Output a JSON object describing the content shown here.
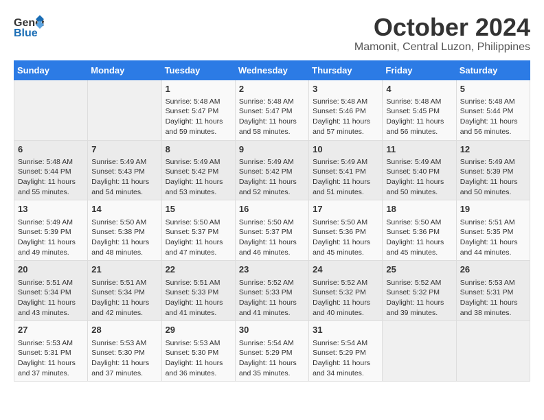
{
  "header": {
    "logo_line1": "General",
    "logo_line2": "Blue",
    "month_title": "October 2024",
    "subtitle": "Mamonit, Central Luzon, Philippines"
  },
  "days_of_week": [
    "Sunday",
    "Monday",
    "Tuesday",
    "Wednesday",
    "Thursday",
    "Friday",
    "Saturday"
  ],
  "weeks": [
    [
      {
        "day": "",
        "content": ""
      },
      {
        "day": "",
        "content": ""
      },
      {
        "day": "1",
        "content": "Sunrise: 5:48 AM\nSunset: 5:47 PM\nDaylight: 11 hours and 59 minutes."
      },
      {
        "day": "2",
        "content": "Sunrise: 5:48 AM\nSunset: 5:47 PM\nDaylight: 11 hours and 58 minutes."
      },
      {
        "day": "3",
        "content": "Sunrise: 5:48 AM\nSunset: 5:46 PM\nDaylight: 11 hours and 57 minutes."
      },
      {
        "day": "4",
        "content": "Sunrise: 5:48 AM\nSunset: 5:45 PM\nDaylight: 11 hours and 56 minutes."
      },
      {
        "day": "5",
        "content": "Sunrise: 5:48 AM\nSunset: 5:44 PM\nDaylight: 11 hours and 56 minutes."
      }
    ],
    [
      {
        "day": "6",
        "content": "Sunrise: 5:48 AM\nSunset: 5:44 PM\nDaylight: 11 hours and 55 minutes."
      },
      {
        "day": "7",
        "content": "Sunrise: 5:49 AM\nSunset: 5:43 PM\nDaylight: 11 hours and 54 minutes."
      },
      {
        "day": "8",
        "content": "Sunrise: 5:49 AM\nSunset: 5:42 PM\nDaylight: 11 hours and 53 minutes."
      },
      {
        "day": "9",
        "content": "Sunrise: 5:49 AM\nSunset: 5:42 PM\nDaylight: 11 hours and 52 minutes."
      },
      {
        "day": "10",
        "content": "Sunrise: 5:49 AM\nSunset: 5:41 PM\nDaylight: 11 hours and 51 minutes."
      },
      {
        "day": "11",
        "content": "Sunrise: 5:49 AM\nSunset: 5:40 PM\nDaylight: 11 hours and 50 minutes."
      },
      {
        "day": "12",
        "content": "Sunrise: 5:49 AM\nSunset: 5:39 PM\nDaylight: 11 hours and 50 minutes."
      }
    ],
    [
      {
        "day": "13",
        "content": "Sunrise: 5:49 AM\nSunset: 5:39 PM\nDaylight: 11 hours and 49 minutes."
      },
      {
        "day": "14",
        "content": "Sunrise: 5:50 AM\nSunset: 5:38 PM\nDaylight: 11 hours and 48 minutes."
      },
      {
        "day": "15",
        "content": "Sunrise: 5:50 AM\nSunset: 5:37 PM\nDaylight: 11 hours and 47 minutes."
      },
      {
        "day": "16",
        "content": "Sunrise: 5:50 AM\nSunset: 5:37 PM\nDaylight: 11 hours and 46 minutes."
      },
      {
        "day": "17",
        "content": "Sunrise: 5:50 AM\nSunset: 5:36 PM\nDaylight: 11 hours and 45 minutes."
      },
      {
        "day": "18",
        "content": "Sunrise: 5:50 AM\nSunset: 5:36 PM\nDaylight: 11 hours and 45 minutes."
      },
      {
        "day": "19",
        "content": "Sunrise: 5:51 AM\nSunset: 5:35 PM\nDaylight: 11 hours and 44 minutes."
      }
    ],
    [
      {
        "day": "20",
        "content": "Sunrise: 5:51 AM\nSunset: 5:34 PM\nDaylight: 11 hours and 43 minutes."
      },
      {
        "day": "21",
        "content": "Sunrise: 5:51 AM\nSunset: 5:34 PM\nDaylight: 11 hours and 42 minutes."
      },
      {
        "day": "22",
        "content": "Sunrise: 5:51 AM\nSunset: 5:33 PM\nDaylight: 11 hours and 41 minutes."
      },
      {
        "day": "23",
        "content": "Sunrise: 5:52 AM\nSunset: 5:33 PM\nDaylight: 11 hours and 41 minutes."
      },
      {
        "day": "24",
        "content": "Sunrise: 5:52 AM\nSunset: 5:32 PM\nDaylight: 11 hours and 40 minutes."
      },
      {
        "day": "25",
        "content": "Sunrise: 5:52 AM\nSunset: 5:32 PM\nDaylight: 11 hours and 39 minutes."
      },
      {
        "day": "26",
        "content": "Sunrise: 5:53 AM\nSunset: 5:31 PM\nDaylight: 11 hours and 38 minutes."
      }
    ],
    [
      {
        "day": "27",
        "content": "Sunrise: 5:53 AM\nSunset: 5:31 PM\nDaylight: 11 hours and 37 minutes."
      },
      {
        "day": "28",
        "content": "Sunrise: 5:53 AM\nSunset: 5:30 PM\nDaylight: 11 hours and 37 minutes."
      },
      {
        "day": "29",
        "content": "Sunrise: 5:53 AM\nSunset: 5:30 PM\nDaylight: 11 hours and 36 minutes."
      },
      {
        "day": "30",
        "content": "Sunrise: 5:54 AM\nSunset: 5:29 PM\nDaylight: 11 hours and 35 minutes."
      },
      {
        "day": "31",
        "content": "Sunrise: 5:54 AM\nSunset: 5:29 PM\nDaylight: 11 hours and 34 minutes."
      },
      {
        "day": "",
        "content": ""
      },
      {
        "day": "",
        "content": ""
      }
    ]
  ]
}
